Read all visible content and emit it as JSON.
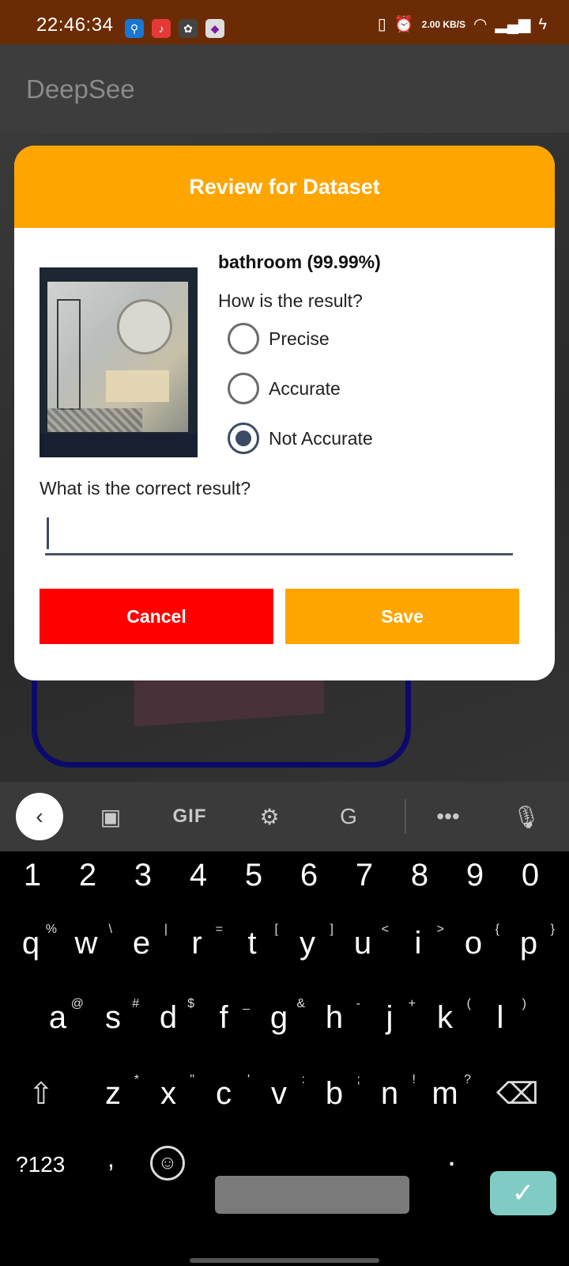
{
  "status_bar": {
    "time": "22:46:34",
    "network_speed": "2.00 KB/S",
    "app_icons": [
      "usb-icon",
      "music-icon",
      "openai-icon",
      "chat-app-icon"
    ],
    "system_icons": [
      "vibrate-icon",
      "alarm-icon",
      "wifi-icon",
      "signal-icon",
      "charging-icon"
    ]
  },
  "app": {
    "title": "DeepSee"
  },
  "dialog": {
    "title": "Review for Dataset",
    "result_label": "bathroom (99.99%)",
    "question": "How is the result?",
    "options": [
      {
        "label": "Precise",
        "checked": false
      },
      {
        "label": "Accurate",
        "checked": false
      },
      {
        "label": "Not Accurate",
        "checked": true
      }
    ],
    "correct_question": "What is the correct result?",
    "correct_input_value": "",
    "cancel_label": "Cancel",
    "save_label": "Save",
    "colors": {
      "header": "#ffa500",
      "cancel": "#ff0000",
      "save": "#ffa500"
    }
  },
  "keyboard": {
    "toolbar": {
      "gif_label": "GIF"
    },
    "numbers": [
      "1",
      "2",
      "3",
      "4",
      "5",
      "6",
      "7",
      "8",
      "9",
      "0"
    ],
    "row1": [
      [
        "q",
        "%"
      ],
      [
        "w",
        "\\"
      ],
      [
        "e",
        "|"
      ],
      [
        "r",
        "="
      ],
      [
        "t",
        "["
      ],
      [
        "y",
        "]"
      ],
      [
        "u",
        "<"
      ],
      [
        "i",
        ">"
      ],
      [
        "o",
        "{"
      ],
      [
        "p",
        "}"
      ]
    ],
    "row2": [
      [
        "a",
        "@"
      ],
      [
        "s",
        "#"
      ],
      [
        "d",
        "$"
      ],
      [
        "f",
        "_"
      ],
      [
        "g",
        "&"
      ],
      [
        "h",
        "-"
      ],
      [
        "j",
        "+"
      ],
      [
        "k",
        "("
      ],
      [
        "l",
        ")"
      ]
    ],
    "row3": [
      [
        "z",
        "*"
      ],
      [
        "x",
        "\""
      ],
      [
        "c",
        "'"
      ],
      [
        "v",
        ":"
      ],
      [
        "b",
        ";"
      ],
      [
        "n",
        "!"
      ],
      [
        "m",
        "?"
      ]
    ],
    "sym_label": "?123",
    "comma": ",",
    "period": "."
  }
}
